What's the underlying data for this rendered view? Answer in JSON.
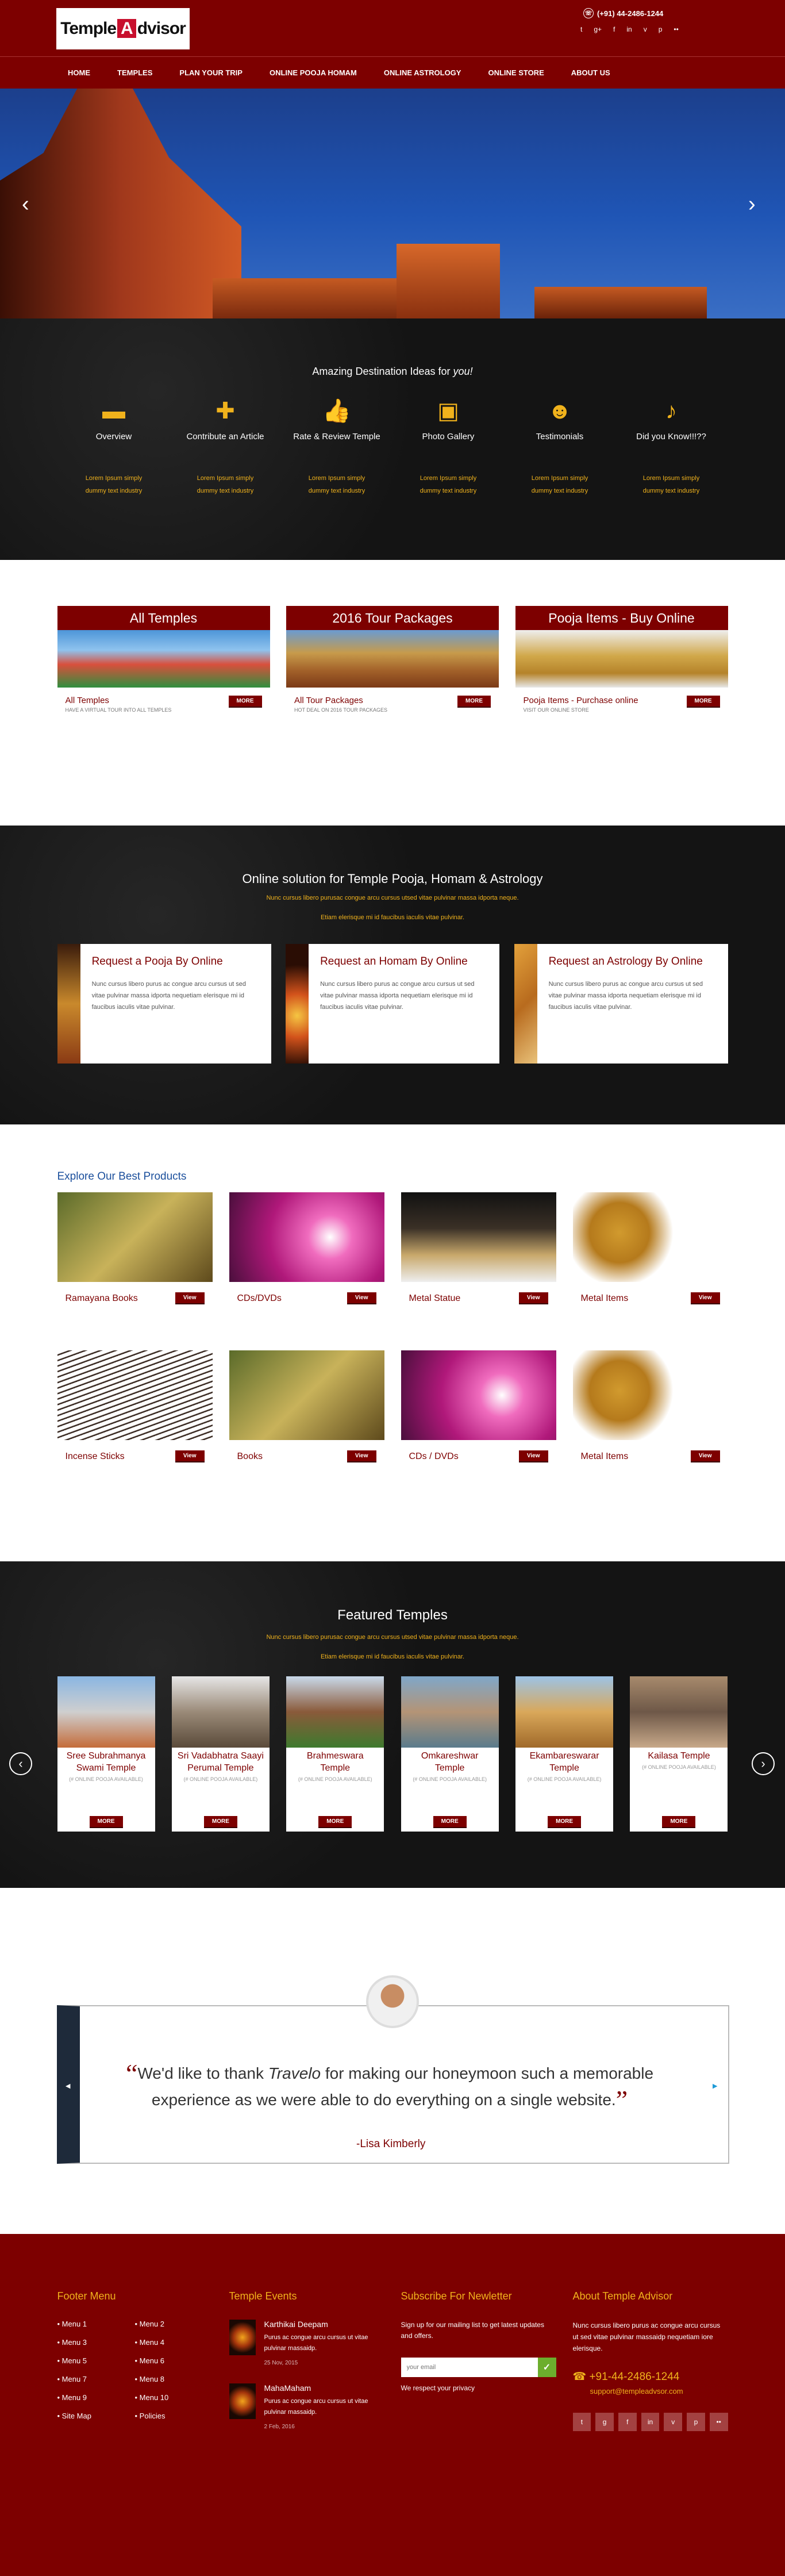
{
  "header": {
    "logo_text_1": "Temple",
    "logo_text_2": "A",
    "logo_text_3": "dvisor",
    "phone": "(+91) 44-2486-1244",
    "social_icons": [
      "twitter-icon",
      "google-plus-icon",
      "facebook-icon",
      "linkedin-icon",
      "vimeo-icon",
      "pinterest-icon",
      "flickr-icon"
    ]
  },
  "nav": [
    "HOME",
    "TEMPLES",
    "PLAN YOUR TRIP",
    "ONLINE POOJA   HOMAM",
    "ONLINE ASTROLOGY",
    "ONLINE STORE",
    "ABOUT US"
  ],
  "ideas": {
    "title_pre": "Amazing Destination Ideas for ",
    "title_em": "you!",
    "items": [
      {
        "label": "Overview",
        "desc": "Lorem Ipsum simply dummy text industry"
      },
      {
        "label": "Contribute an Article",
        "desc": "Lorem Ipsum simply dummy text industry"
      },
      {
        "label": "Rate & Review Temple",
        "desc": "Lorem Ipsum simply dummy text industry"
      },
      {
        "label": "Photo Gallery",
        "desc": "Lorem Ipsum simply dummy text industry"
      },
      {
        "label": "Testimonials",
        "desc": "Lorem Ipsum simply dummy text industry"
      },
      {
        "label": "Did you Know!!!??",
        "desc": "Lorem Ipsum simply dummy text industry"
      }
    ]
  },
  "packages": [
    {
      "title": "All Temples",
      "link": "All Temples",
      "sub": "HAVE A VIRTUAL TOUR INTO ALL TEMPLES",
      "button": "MORE"
    },
    {
      "title": "2016 Tour Packages",
      "link": "All Tour Packages",
      "sub": "HOT DEAL ON 2016 TOUR PACKAGES",
      "button": "MORE"
    },
    {
      "title": "Pooja Items - Buy Online",
      "link": "Pooja Items - Purchase online",
      "sub": "VISIT OUR ONLINE STORE",
      "button": "MORE"
    }
  ],
  "online": {
    "title": "Online solution for Temple Pooja, Homam & Astrology",
    "sub1": "Nunc cursus libero purusac congue arcu cursus utsed vitae pulvinar massa idporta neque.",
    "sub2": "Etiam elerisque mi id faucibus iaculis vitae pulvinar.",
    "cards": [
      {
        "title": "Request a Pooja By Online",
        "text": "Nunc cursus libero purus ac congue arcu cursus ut sed vitae pulvinar massa idporta nequetiam elerisque mi id faucibus iaculis vitae pulvinar."
      },
      {
        "title": "Request an Homam By Online",
        "text": "Nunc cursus libero purus ac congue arcu cursus ut sed vitae pulvinar massa idporta nequetiam elerisque mi id faucibus iaculis vitae pulvinar."
      },
      {
        "title": "Request an Astrology By Online",
        "text": "Nunc cursus libero purus ac congue arcu cursus ut sed vitae pulvinar massa idporta nequetiam elerisque mi id faucibus iaculis vitae pulvinar."
      }
    ]
  },
  "products": {
    "title": "Explore Our Best Products",
    "items": [
      {
        "name": "Ramayana Books",
        "button": "View"
      },
      {
        "name": "CDs/DVDs",
        "button": "View"
      },
      {
        "name": "Metal Statue",
        "button": "View"
      },
      {
        "name": "Metal Items",
        "button": "View"
      },
      {
        "name": "Incense Sticks",
        "button": "View"
      },
      {
        "name": "Books",
        "button": "View"
      },
      {
        "name": "CDs / DVDs",
        "button": "View"
      },
      {
        "name": "Metal Items",
        "button": "View"
      }
    ]
  },
  "featured": {
    "title": "Featured Temples",
    "sub1": "Nunc cursus libero purusac congue arcu cursus utsed vitae pulvinar massa idporta neque.",
    "sub2": "Etiam elerisque mi id faucibus iaculis vitae pulvinar.",
    "temples": [
      {
        "name": "Sree Subrahmanya Swami Temple",
        "sub": "(# ONLINE POOJA AVAILABLE)",
        "button": "MORE"
      },
      {
        "name": "Sri Vadabhatra Saayi Perumal Temple",
        "sub": "(# ONLINE POOJA AVAILABLE)",
        "button": "MORE"
      },
      {
        "name": "Brahmeswara Temple",
        "sub": "(# ONLINE POOJA AVAILABLE)",
        "button": "MORE"
      },
      {
        "name": "Omkareshwar Temple",
        "sub": "(# ONLINE POOJA AVAILABLE)",
        "button": "MORE"
      },
      {
        "name": "Ekambareswarar Temple",
        "sub": "(# ONLINE POOJA AVAILABLE)",
        "button": "MORE"
      },
      {
        "name": "Kailasa Temple",
        "sub": "(# ONLINE POOJA AVAILABLE)",
        "button": "MORE"
      }
    ]
  },
  "testimonial": {
    "q1": "We'd like to thank ",
    "brand": "Travelo",
    "q2": " for making our honeymoon such a memorable experience as we were able to do everything on a single website.",
    "author": "-Lisa Kimberly"
  },
  "footer": {
    "menu_title": "Footer Menu",
    "menu": [
      "Menu 1",
      "Menu 2",
      "Menu 3",
      "Menu 4",
      "Menu 5",
      "Menu 6",
      "Menu 7",
      "Menu 8",
      "Menu 9",
      "Menu 10",
      "Site Map",
      "Policies"
    ],
    "events_title": "Temple Events",
    "events": [
      {
        "title": "Karthikai Deepam",
        "text": "Purus ac congue arcu cursus ut vitae pulvinar massaidp.",
        "date": "25 Nov, 2015"
      },
      {
        "title": "MahaMaham",
        "text": "Purus ac congue arcu cursus ut vitae pulvinar massaidp.",
        "date": "2 Feb, 2016"
      }
    ],
    "newsletter_title": "Subscribe For Newletter",
    "newsletter_text": "Sign up for our mailing list to get latest updates and offers.",
    "email_placeholder": "your email",
    "privacy": "We respect your privacy",
    "about_title": "About Temple Advisor",
    "about_text": "Nunc cursus libero purus ac congue arcu cursus ut sed vitae pulvinar massaidp nequetiam iore elerisque.",
    "phone": "+91-44-2486-1244",
    "email": "support@templeadvsor.com"
  }
}
